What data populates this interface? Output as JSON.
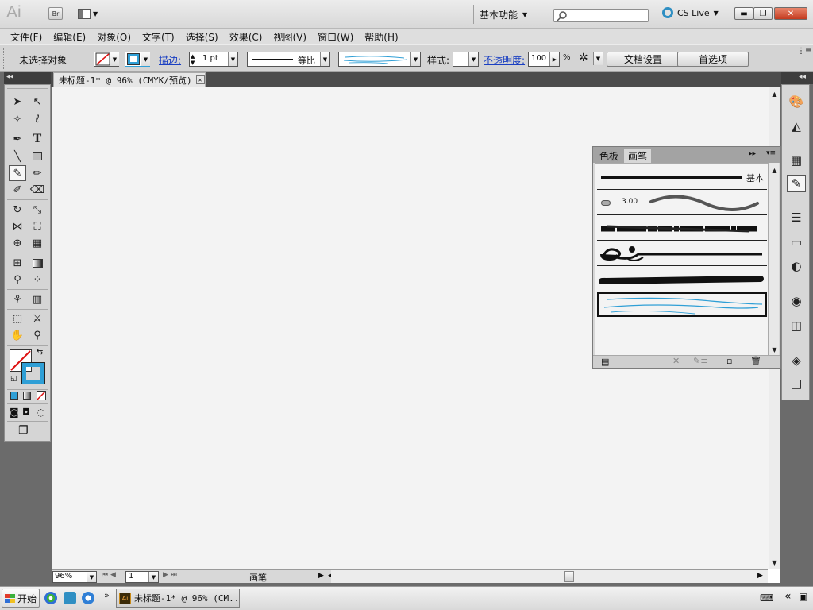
{
  "app": {
    "logo": "Ai",
    "bridge": "Br"
  },
  "titlebar": {
    "workspace_label": "基本功能",
    "search_placeholder": "",
    "cs_live": "CS Live"
  },
  "menu": [
    "文件(F)",
    "编辑(E)",
    "对象(O)",
    "文字(T)",
    "选择(S)",
    "效果(C)",
    "视图(V)",
    "窗口(W)",
    "帮助(H)"
  ],
  "control": {
    "no_selection": "未选择对象",
    "stroke_label": "描边:",
    "stroke_weight": "1 pt",
    "profile_label": "等比",
    "style_label": "样式:",
    "opacity_label": "不透明度:",
    "opacity_value": "100",
    "percent": "%",
    "doc_setup": "文档设置",
    "preferences": "首选项"
  },
  "document": {
    "tab_title": "未标题-1* @ 96% (CMYK/预览)"
  },
  "status": {
    "zoom": "96%",
    "artboard": "1",
    "tool_name": "画笔"
  },
  "brush_panel": {
    "tab_swatches": "色板",
    "tab_brushes": "画笔",
    "basic_label": "基本",
    "brush_size": "3.00"
  },
  "taskbar": {
    "start": "开始",
    "task_title": "未标题-1* @ 96% (CM..."
  },
  "colors": {
    "accent_blue": "#2f9fd6",
    "close_red": "#c43b20",
    "link_blue": "#1a3fc2"
  }
}
